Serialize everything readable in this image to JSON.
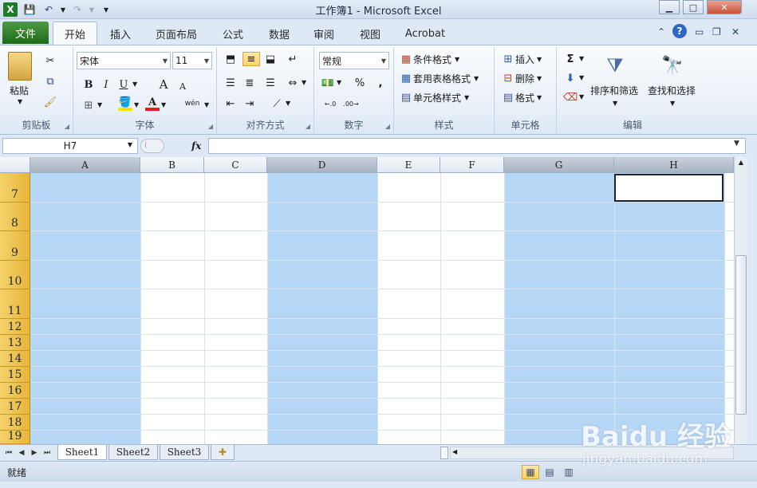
{
  "window": {
    "title": "工作簿1 - Microsoft Excel",
    "buttons": {
      "minimize": "▁",
      "maximize": "□",
      "close": "✕"
    }
  },
  "quick_access": {
    "save": "💾",
    "undo": "↶",
    "redo": "↷",
    "customize": "▾"
  },
  "tabs": {
    "file": "文件",
    "items": [
      "开始",
      "插入",
      "页面布局",
      "公式",
      "数据",
      "审阅",
      "视图",
      "Acrobat"
    ],
    "active": "开始"
  },
  "ribbon": {
    "clipboard": {
      "label": "剪贴板",
      "paste": "粘贴"
    },
    "font": {
      "label": "字体",
      "name": "宋体",
      "size": "11",
      "bold": "B",
      "italic": "I",
      "underline": "U",
      "grow": "A",
      "shrink": "A",
      "phonetic": "wén",
      "font_color_letter": "A"
    },
    "alignment": {
      "label": "对齐方式"
    },
    "number": {
      "label": "数字",
      "format": "常规",
      "percent": "%",
      "comma": ",",
      "inc_dec": ".0 .00",
      "dec_dec": ".00 .0"
    },
    "styles": {
      "label": "样式",
      "conditional": "条件格式",
      "table": "套用表格格式",
      "cell": "单元格样式"
    },
    "cells": {
      "label": "单元格",
      "insert": "插入",
      "delete": "删除",
      "format": "格式"
    },
    "editing": {
      "label": "编辑",
      "sum": "Σ",
      "sort": "排序和筛选",
      "find": "查找和选择"
    }
  },
  "formula_bar": {
    "name_box": "H7",
    "fx": "fx",
    "formula": ""
  },
  "grid": {
    "columns": [
      "A",
      "B",
      "C",
      "D",
      "E",
      "F",
      "G",
      "H"
    ],
    "selected_columns": [
      "A",
      "D",
      "G",
      "H"
    ],
    "rows": [
      "7",
      "8",
      "9",
      "10",
      "11",
      "12",
      "13",
      "14",
      "15",
      "16",
      "17",
      "18",
      "19"
    ],
    "active_cell": "H7",
    "selection_color": "#b6d6f6",
    "row_header_color": "#efc452"
  },
  "sheets": {
    "items": [
      "Sheet1",
      "Sheet2",
      "Sheet3"
    ],
    "active": "Sheet1"
  },
  "status": {
    "ready": "就绪"
  },
  "watermark": {
    "brand": "Baidu 经验",
    "url": "jingyan.baidu.com"
  }
}
